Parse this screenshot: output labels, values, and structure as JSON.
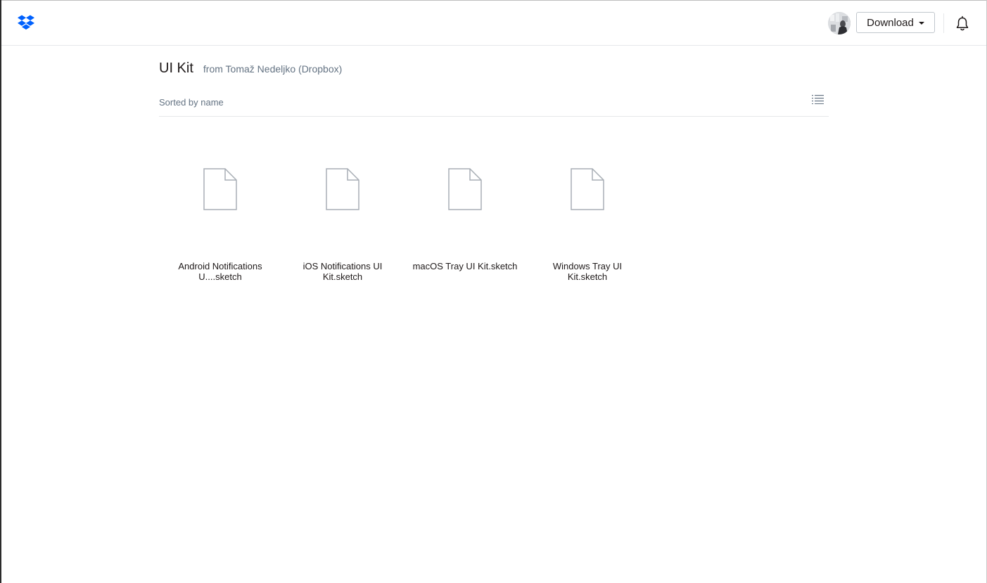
{
  "header": {
    "logo_icon": "dropbox-logo-icon",
    "brand_color": "#0061fe",
    "download_label": "Download",
    "notification_icon": "bell-icon"
  },
  "folder": {
    "title": "UI Kit",
    "owner": "from Tomaž Nedeljko (Dropbox)"
  },
  "sort": {
    "label": "Sorted by name",
    "view_icon": "list-view-icon"
  },
  "files": [
    {
      "name": "Android Notifications U....sketch",
      "icon": "file-icon"
    },
    {
      "name": "iOS Notifications UI Kit.sketch",
      "icon": "file-icon"
    },
    {
      "name": "macOS Tray UI Kit.sketch",
      "icon": "file-icon"
    },
    {
      "name": "Windows Tray UI Kit.sketch",
      "icon": "file-icon"
    }
  ]
}
